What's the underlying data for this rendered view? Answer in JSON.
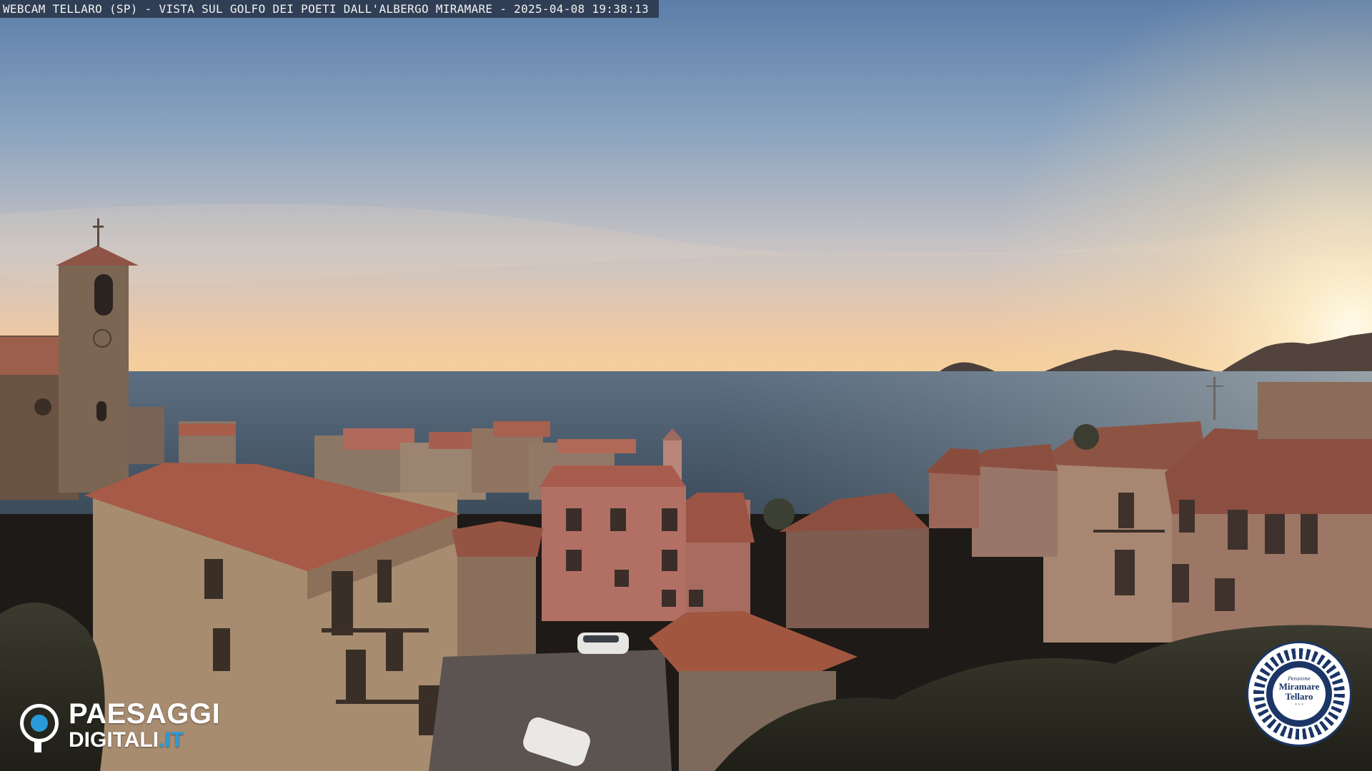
{
  "caption": "WEBCAM TELLARO (SP) - VISTA SUL GOLFO DEI POETI DALL'ALBERGO MIRAMARE - 2025-04-08 19:38:13",
  "logo": {
    "line1": "PAESAGGI",
    "line2_main": "DIGITALI",
    "line2_tld": ".IT"
  },
  "badge": {
    "small": "Pensione",
    "name": "Miramare",
    "place": "Tellaro"
  },
  "colors": {
    "logo_blue": "#2a9ad8",
    "badge_navy": "#1b3566",
    "sea": "#56677a",
    "roof": "#b65f43"
  },
  "icons": {
    "logo": "paesaggi-digitali-eye-logo",
    "badge": "rope-ring-badge"
  }
}
